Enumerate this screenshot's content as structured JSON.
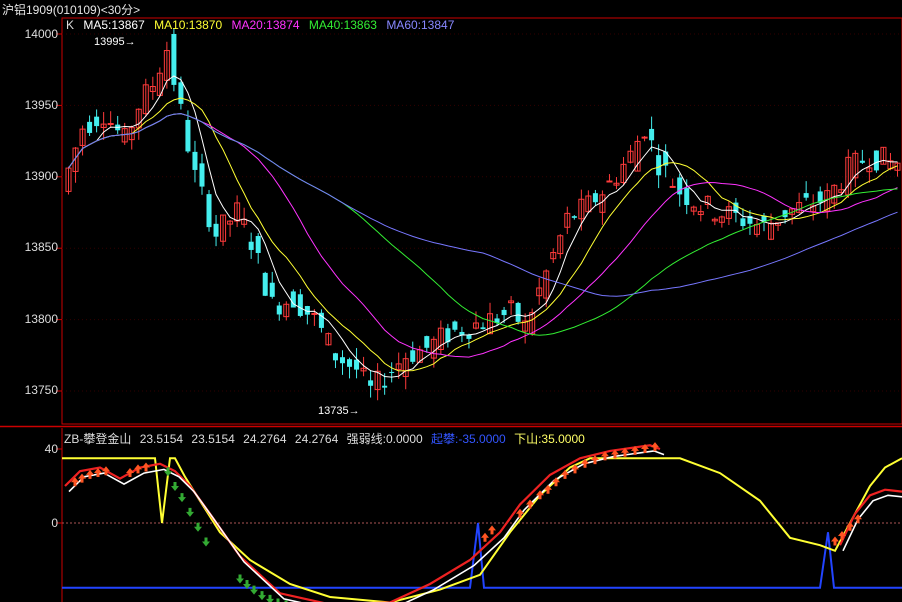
{
  "title": "沪铝1909(010109)<30分>",
  "legend": {
    "k": "K",
    "ma5": "MA5:13867",
    "ma10": "MA10:13870",
    "ma20": "MA20:13874",
    "ma40": "MA40:13863",
    "ma60": "MA60:13847"
  },
  "colors": {
    "up": "#ff3b3b",
    "down": "#44eeee",
    "ma5": "#ffffff",
    "ma10": "#ffff33",
    "ma20": "#ff33ff",
    "ma40": "#33ee33",
    "ma60": "#7777ff",
    "frame": "#cc0000"
  },
  "price_axis": {
    "labels": [
      "14000",
      "13950",
      "13900",
      "13850",
      "13800",
      "13750"
    ]
  },
  "marks": {
    "high": "13995",
    "low": "13735"
  },
  "indicator": {
    "name": "ZB-攀登金山",
    "v1": "23.5154",
    "v2": "23.5154",
    "v3": "24.2764",
    "v4": "24.2764",
    "strength": "强弱线:0.0000",
    "climb": "起攀:-35.0000",
    "down": "下山:35.0000",
    "axis_labels": [
      "40",
      "0"
    ]
  },
  "chart_data": {
    "type": "candlestick",
    "price_range": [
      13725,
      14010
    ],
    "indicator_range": [
      -40,
      40
    ],
    "high": 13995,
    "low": 13735
  }
}
